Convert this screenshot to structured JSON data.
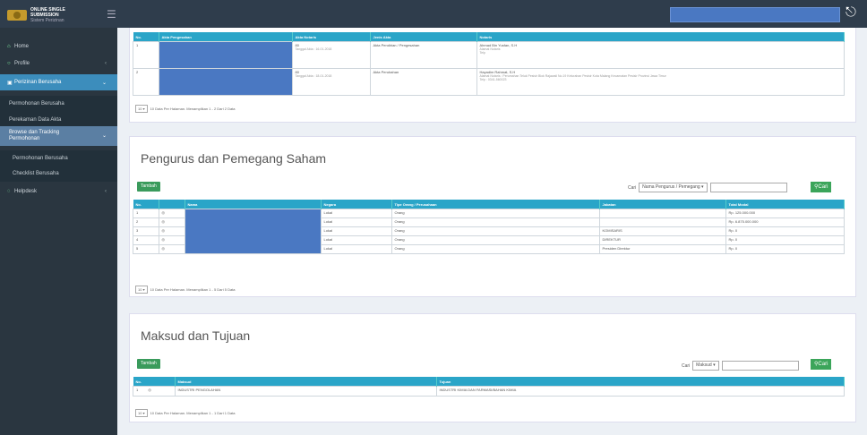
{
  "app": {
    "logo_line1": "ONLINE SINGLE SUBMISSION",
    "logo_line2": "Sistem Perizinan"
  },
  "sidebar": {
    "home": "Home",
    "profile": "Profile",
    "perizinan": "Perizinan Berusaha",
    "permohonan": "Permohonan Berusaha",
    "perekaman": "Perekaman Data Akta",
    "browse": "Browse dan Tracking Permohonan",
    "permohonan2": "Permohonan Berusaha",
    "checklist": "Checklist Berusaha",
    "helpdesk": "Helpdesk"
  },
  "akta": {
    "headers": [
      "No.",
      "Akta Pengesahan",
      "Akta Notaris",
      "Jenis Akta",
      "Notaris"
    ],
    "rows": [
      {
        "no": "1",
        "akta_notaris": "80",
        "akta_notaris_sub": "Tanggal Akta : 16-01-2018",
        "jenis": "Akta Pendirian / Pengesahan",
        "notaris": "Ahmad Bin Yusfan, S.H",
        "notaris_sub": "Alamat Notaris",
        "notaris_sub2": "Telp"
      },
      {
        "no": "2",
        "akta_notaris": "80",
        "akta_notaris_sub": "Tanggal Akta : 18-01-2018",
        "jenis": "Akta Perubahan",
        "notaris": "Hayadim Rahmat, S.H",
        "notaris_sub": "Alamat Notaris : Perumahan Teluk Pesisir Blok Rajawali No.19 Kelurahan Pesisir Kota Malang Kecamatan Pesisir Provinsi Jawa Timur",
        "notaris_sub2": "Telp : 0341-560023"
      }
    ],
    "footer": "10 Data Per Halaman. Menampilkan 1 - 2 Dari 2 Data"
  },
  "pengurus": {
    "title": "Pengurus dan Pemegang Saham",
    "tambah": "Tambah",
    "cari_label": "Cari",
    "cari_select": "Nama Pengurus / Pemegang",
    "cari_btn": "Cari",
    "headers": [
      "No.",
      "",
      "Nama",
      "Negara",
      "Tipe Orang / Perusahaan",
      "Jabatan",
      "Total Modal"
    ],
    "rows": [
      {
        "no": "1",
        "negara": "Lokal",
        "tipe": "Orang",
        "jabatan": "",
        "modal": "Rp. 125.000.000"
      },
      {
        "no": "2",
        "negara": "Lokal",
        "tipe": "Orang",
        "jabatan": "",
        "modal": "Rp. 6.875.000.000"
      },
      {
        "no": "3",
        "negara": "Lokal",
        "tipe": "Orang",
        "jabatan": "KOMISARIS",
        "modal": "Rp. 0"
      },
      {
        "no": "4",
        "negara": "Lokal",
        "tipe": "Orang",
        "jabatan": "DIREKTUR",
        "modal": "Rp. 0"
      },
      {
        "no": "5",
        "negara": "Lokal",
        "tipe": "Orang",
        "jabatan": "Presiden Direktur",
        "modal": "Rp. 0"
      }
    ],
    "footer": "10 Data Per Halaman. Menampilkan 1 - 5 Dari 5 Data"
  },
  "maksud": {
    "title": "Maksud dan Tujuan",
    "tambah": "Tambah",
    "cari_label": "Cari",
    "cari_select": "Maksud",
    "cari_btn": "Cari",
    "headers": [
      "No.",
      "Maksud",
      "Tujuan"
    ],
    "rows": [
      {
        "no": "1",
        "maksud": "INDUSTRI PENGOLAHAN",
        "tujuan": "INDUSTRI KIMIA DAN FARMASI/BAHAN KIMIA"
      }
    ],
    "footer": "10 Data Per Halaman. Menampilkan 1 - 1 Dari 1 Data"
  },
  "pager": {
    "per_page": "10"
  },
  "colors": {
    "topbar": "#2f3d4c",
    "sidebar": "#2a3640",
    "accent": "#3c8dbc",
    "table_header": "#2aa5c8",
    "green_btn": "#3a9b5c",
    "redaction": "#4a78c2"
  }
}
